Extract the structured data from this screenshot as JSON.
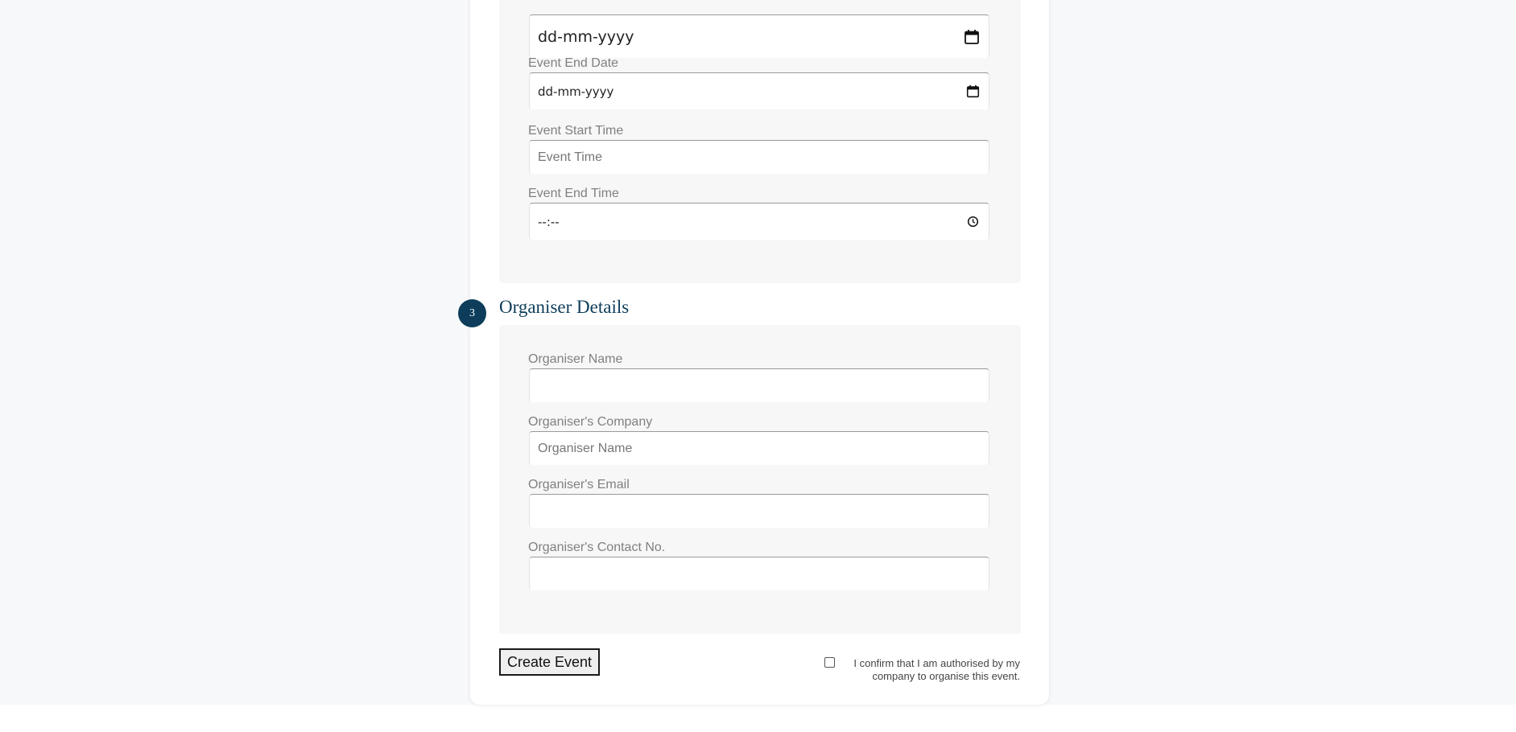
{
  "event_schedule": {
    "start_date": {
      "value": "dd-mm-yyyy",
      "icon": "calendar-icon"
    },
    "end_date": {
      "label": "Event End Date",
      "value": "dd-mm-yyyy",
      "icon": "calendar-icon"
    },
    "start_time": {
      "label": "Event Start Time",
      "placeholder": "Event Time"
    },
    "end_time": {
      "label": "Event End Time",
      "value": "--:--",
      "icon": "clock-icon"
    }
  },
  "organiser_section": {
    "step_number": "3",
    "title": "Organiser Details",
    "fields": {
      "name": {
        "label": "Organiser Name",
        "placeholder": ""
      },
      "company": {
        "label": "Organiser's Company",
        "placeholder": "Organiser Name"
      },
      "email": {
        "label": "Organiser's Email",
        "placeholder": ""
      },
      "contact": {
        "label": "Organiser's Contact No.",
        "placeholder": ""
      }
    }
  },
  "actions": {
    "create_label": "Create Event",
    "confirm_line1": "I confirm that I am authorised by my",
    "confirm_line2": "company to organise this event.",
    "confirm_checked": false
  },
  "colors": {
    "accent": "#0d3d5a",
    "page_background": "#f7f8fa",
    "panel_background": "#f7f7f7",
    "label_text": "#808080"
  }
}
